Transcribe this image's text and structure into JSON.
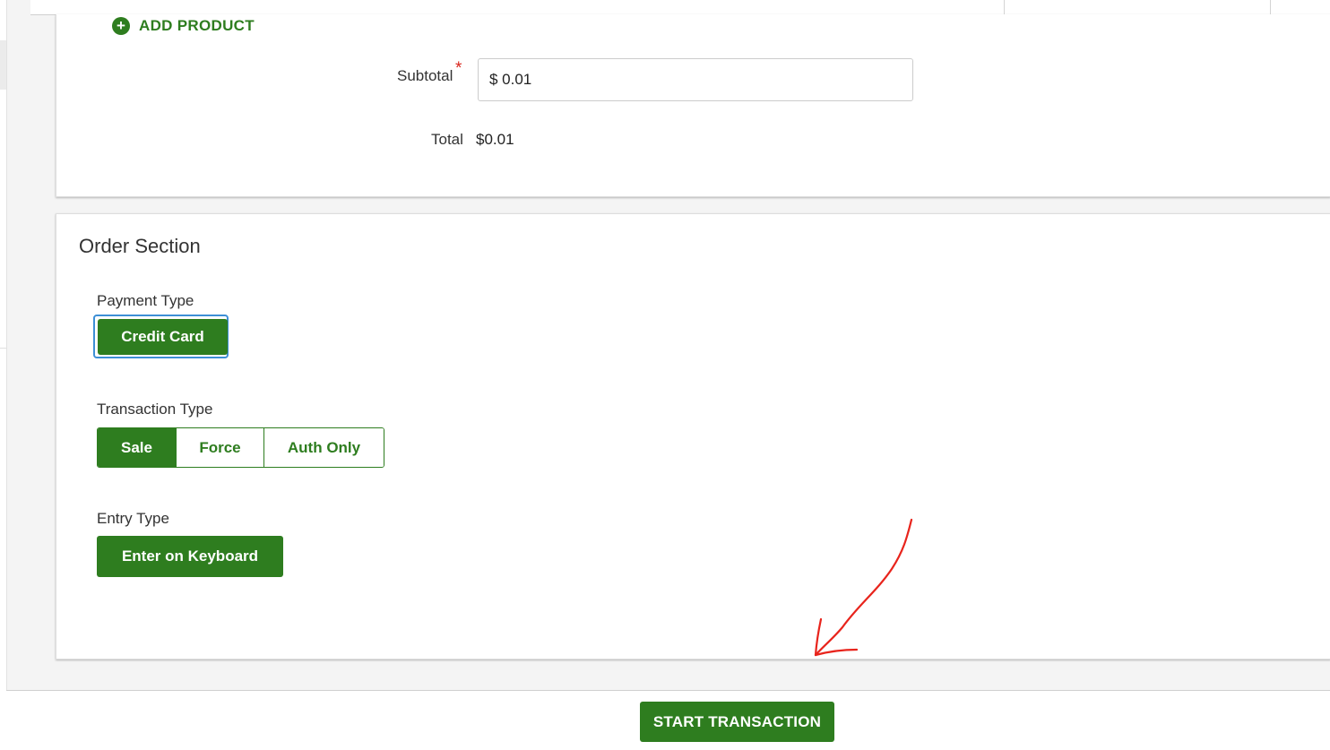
{
  "products": {
    "add_product_label": "ADD PRODUCT",
    "add_product_icon": "plus-circle-icon",
    "subtotal_label": "Subtotal",
    "required_marker": "*",
    "subtotal_value": "$ 0.01",
    "total_label": "Total",
    "total_value": "$0.01"
  },
  "order": {
    "title": "Order Section",
    "payment_type": {
      "label": "Payment Type",
      "options": [
        "Credit Card"
      ],
      "selected": "Credit Card"
    },
    "transaction_type": {
      "label": "Transaction Type",
      "options": [
        "Sale",
        "Force",
        "Auth Only"
      ],
      "selected": "Sale"
    },
    "entry_type": {
      "label": "Entry Type",
      "options": [
        "Enter on Keyboard"
      ],
      "selected": "Enter on Keyboard"
    }
  },
  "footer": {
    "start_label": "START TRANSACTION"
  },
  "annotation": {
    "arrow_icon": "hand-drawn-arrow-icon",
    "color": "#e8241c"
  },
  "colors": {
    "accent": "#2e7d1f",
    "focus_ring": "#3d8fd6",
    "required": "#d9251c",
    "page_bg": "#f4f4f4"
  }
}
